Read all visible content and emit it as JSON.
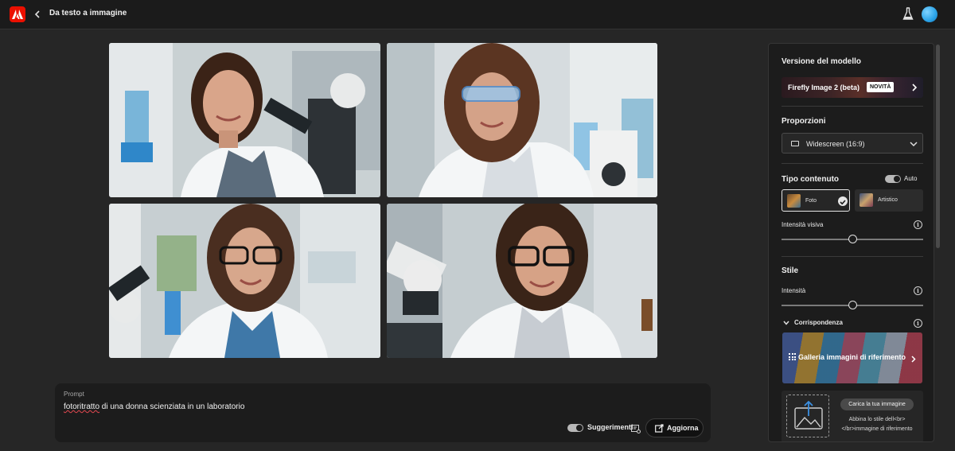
{
  "header": {
    "title": "Da testo a immagine"
  },
  "images": [
    {
      "name": "generated-image-1"
    },
    {
      "name": "generated-image-2"
    },
    {
      "name": "generated-image-3"
    },
    {
      "name": "generated-image-4"
    }
  ],
  "prompt": {
    "label": "Prompt",
    "text_misspelled": "fotoritratto",
    "text_rest": " di una donna scienziata in un laboratorio",
    "suggestions_label": "Suggerimenti",
    "update_label": "Aggiorna"
  },
  "panel": {
    "model_section_title": "Versione del modello",
    "model_name": "Firefly Image 2 (beta)",
    "model_badge": "NOVITÀ",
    "proportions_title": "Proporzioni",
    "proportions_value": "Widescreen (16:9)",
    "content_type_title": "Tipo contenuto",
    "auto_label": "Auto",
    "photo_label": "Foto",
    "art_label": "Artistico",
    "visual_intensity_label": "Intensità visiva",
    "visual_intensity_value": 0.5,
    "style_title": "Stile",
    "intensity_label": "Intensità",
    "intensity_value": 0.5,
    "match_label": "Corrispondenza",
    "gallery_label": "Galleria immagini di riferimento",
    "upload_button": "Carica la tua immagine",
    "upload_hint": "Abbina lo stile dell<br></br>immagine di riferimento"
  },
  "colors": {
    "brand_red": "#eb1000",
    "background": "#262626",
    "panel": "#1c1c1c"
  }
}
